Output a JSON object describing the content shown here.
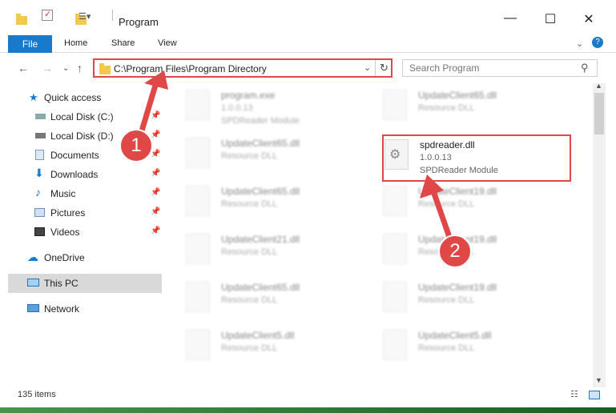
{
  "window": {
    "title": "Program"
  },
  "ribbon": {
    "file": "File",
    "tabs": [
      "Home",
      "Share",
      "View"
    ]
  },
  "address": {
    "path": "C:\\Program Files\\Program Directory"
  },
  "search": {
    "placeholder": "Search Program"
  },
  "sidebar": {
    "items": [
      {
        "label": "Quick access",
        "icon": "star-icon"
      },
      {
        "label": "Local Disk (C:)",
        "icon": "drive-icon"
      },
      {
        "label": "Local Disk (D:)",
        "icon": "drive-icon"
      },
      {
        "label": "Documents",
        "icon": "documents-icon"
      },
      {
        "label": "Downloads",
        "icon": "download-icon"
      },
      {
        "label": "Music",
        "icon": "music-icon"
      },
      {
        "label": "Pictures",
        "icon": "pictures-icon"
      },
      {
        "label": "Videos",
        "icon": "videos-icon"
      },
      {
        "label": "OneDrive",
        "icon": "cloud-icon"
      },
      {
        "label": "This PC",
        "icon": "computer-icon"
      },
      {
        "label": "Network",
        "icon": "network-icon"
      }
    ]
  },
  "files": [
    {
      "name": "program.exe",
      "line2": "1.0.0.13",
      "line3": "SPDReader Module"
    },
    {
      "name": "UpdateClient65.dll",
      "line2": "Resource DLL",
      "line3": ""
    },
    {
      "name": "UpdateClient65.dll",
      "line2": "Resource DLL",
      "line3": ""
    },
    {
      "name": "spdreader.dll",
      "line2": "1.0.0.13",
      "line3": "SPDReader Module"
    },
    {
      "name": "UpdateClient65.dll",
      "line2": "Resource DLL",
      "line3": ""
    },
    {
      "name": "UpdateClient19.dll",
      "line2": "Resource DLL",
      "line3": ""
    },
    {
      "name": "UpdateClient21.dll",
      "line2": "Resource DLL",
      "line3": ""
    },
    {
      "name": "UpdateClient19.dll",
      "line2": "Resource DLL",
      "line3": ""
    },
    {
      "name": "UpdateClient65.dll",
      "line2": "Resource DLL",
      "line3": ""
    },
    {
      "name": "UpdateClient19.dll",
      "line2": "Resource DLL",
      "line3": ""
    },
    {
      "name": "UpdateClient5.dll",
      "line2": "Resource DLL",
      "line3": ""
    },
    {
      "name": "UpdateClient5.dll",
      "line2": "Resource DLL",
      "line3": ""
    }
  ],
  "status": {
    "count": "135 items"
  },
  "annotations": {
    "step1": "1",
    "step2": "2"
  },
  "colors": {
    "accent": "#1979ca",
    "highlight": "#e04848"
  }
}
